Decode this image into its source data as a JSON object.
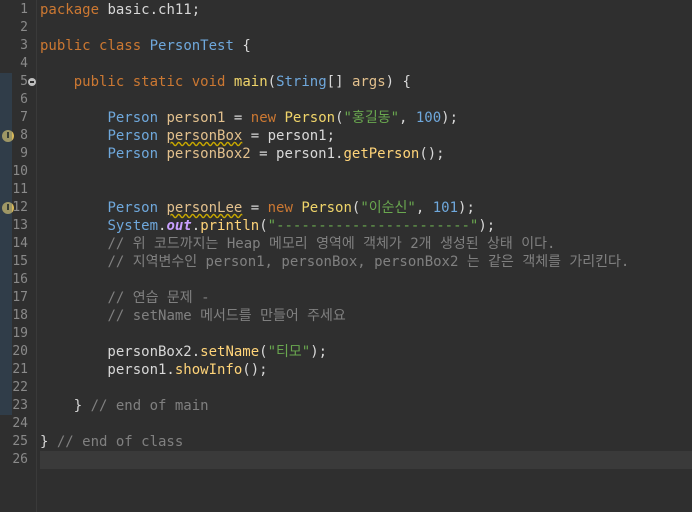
{
  "editor": {
    "lines": [
      {
        "n": "1",
        "segs": [
          [
            "kw",
            "package"
          ],
          [
            "plain",
            " basic.ch11;"
          ]
        ]
      },
      {
        "n": "2",
        "segs": []
      },
      {
        "n": "3",
        "segs": [
          [
            "kw",
            "public"
          ],
          [
            "plain",
            " "
          ],
          [
            "kw",
            "class"
          ],
          [
            "plain",
            " "
          ],
          [
            "type",
            "PersonTest"
          ],
          [
            "plain",
            " {"
          ]
        ]
      },
      {
        "n": "4",
        "segs": []
      },
      {
        "n": "5",
        "segs": [
          [
            "plain",
            "    "
          ],
          [
            "kw",
            "public"
          ],
          [
            "plain",
            " "
          ],
          [
            "kw",
            "static"
          ],
          [
            "plain",
            " "
          ],
          [
            "kw",
            "void"
          ],
          [
            "plain",
            " "
          ],
          [
            "method",
            "main"
          ],
          [
            "plain",
            "("
          ],
          [
            "type",
            "String"
          ],
          [
            "plain",
            "[] "
          ],
          [
            "var",
            "args"
          ],
          [
            "plain",
            ") {"
          ]
        ]
      },
      {
        "n": "6",
        "segs": []
      },
      {
        "n": "7",
        "segs": [
          [
            "plain",
            "        "
          ],
          [
            "type",
            "Person"
          ],
          [
            "plain",
            " "
          ],
          [
            "var",
            "person1"
          ],
          [
            "plain",
            " = "
          ],
          [
            "kw",
            "new"
          ],
          [
            "plain",
            " "
          ],
          [
            "method",
            "Person"
          ],
          [
            "plain",
            "("
          ],
          [
            "str",
            "\"홍길동\""
          ],
          [
            "plain",
            ", "
          ],
          [
            "num",
            "100"
          ],
          [
            "plain",
            ");"
          ]
        ]
      },
      {
        "n": "8",
        "segs": [
          [
            "plain",
            "        "
          ],
          [
            "type",
            "Person"
          ],
          [
            "plain",
            " "
          ],
          [
            "varwarn",
            "personBox"
          ],
          [
            "plain",
            " = person1;"
          ]
        ]
      },
      {
        "n": "9",
        "segs": [
          [
            "plain",
            "        "
          ],
          [
            "type",
            "Person"
          ],
          [
            "plain",
            " "
          ],
          [
            "var",
            "personBox2"
          ],
          [
            "plain",
            " = person1."
          ],
          [
            "call",
            "getPerson"
          ],
          [
            "plain",
            "();"
          ]
        ]
      },
      {
        "n": "10",
        "segs": []
      },
      {
        "n": "11",
        "segs": []
      },
      {
        "n": "12",
        "segs": [
          [
            "plain",
            "        "
          ],
          [
            "type",
            "Person"
          ],
          [
            "plain",
            " "
          ],
          [
            "varwarn",
            "personLee"
          ],
          [
            "plain",
            " = "
          ],
          [
            "kw",
            "new"
          ],
          [
            "plain",
            " "
          ],
          [
            "method",
            "Person"
          ],
          [
            "plain",
            "("
          ],
          [
            "str",
            "\"이순신\""
          ],
          [
            "plain",
            ", "
          ],
          [
            "num",
            "101"
          ],
          [
            "plain",
            ");"
          ]
        ]
      },
      {
        "n": "13",
        "segs": [
          [
            "plain",
            "        "
          ],
          [
            "type",
            "System"
          ],
          [
            "plain",
            "."
          ],
          [
            "static",
            "out"
          ],
          [
            "plain",
            "."
          ],
          [
            "call",
            "println"
          ],
          [
            "plain",
            "("
          ],
          [
            "str",
            "\"-----------------------\""
          ],
          [
            "plain",
            ");"
          ]
        ]
      },
      {
        "n": "14",
        "segs": [
          [
            "plain",
            "        "
          ],
          [
            "cmt",
            "// 위 코드까지는 Heap 메모리 영역에 객체가 2개 생성된 상태 이다."
          ]
        ]
      },
      {
        "n": "15",
        "segs": [
          [
            "plain",
            "        "
          ],
          [
            "cmt",
            "// 지역변수인 person1, personBox, personBox2 는 같은 객체를 가리킨다."
          ]
        ]
      },
      {
        "n": "16",
        "segs": []
      },
      {
        "n": "17",
        "segs": [
          [
            "plain",
            "        "
          ],
          [
            "cmt",
            "// 연습 문제 -"
          ]
        ]
      },
      {
        "n": "18",
        "segs": [
          [
            "plain",
            "        "
          ],
          [
            "cmt",
            "// setName 메서드를 만들어 주세요"
          ]
        ]
      },
      {
        "n": "19",
        "segs": []
      },
      {
        "n": "20",
        "segs": [
          [
            "plain",
            "        personBox2."
          ],
          [
            "call",
            "setName"
          ],
          [
            "plain",
            "("
          ],
          [
            "str",
            "\"티모\""
          ],
          [
            "plain",
            ");"
          ]
        ]
      },
      {
        "n": "21",
        "segs": [
          [
            "plain",
            "        person1."
          ],
          [
            "call",
            "showInfo"
          ],
          [
            "plain",
            "();"
          ]
        ]
      },
      {
        "n": "22",
        "segs": []
      },
      {
        "n": "23",
        "segs": [
          [
            "plain",
            "    } "
          ],
          [
            "cmt",
            "// end of main"
          ]
        ]
      },
      {
        "n": "24",
        "segs": []
      },
      {
        "n": "25",
        "segs": [
          [
            "plain",
            "} "
          ],
          [
            "cmt",
            "// end of class"
          ]
        ]
      },
      {
        "n": "26",
        "segs": []
      }
    ],
    "marker_lines": [
      "8",
      "12"
    ],
    "fold_line": "5",
    "current_line": "26",
    "marker_icon": "warning-lightbulb-icon",
    "fold_icon": "fold-collapse-icon"
  }
}
